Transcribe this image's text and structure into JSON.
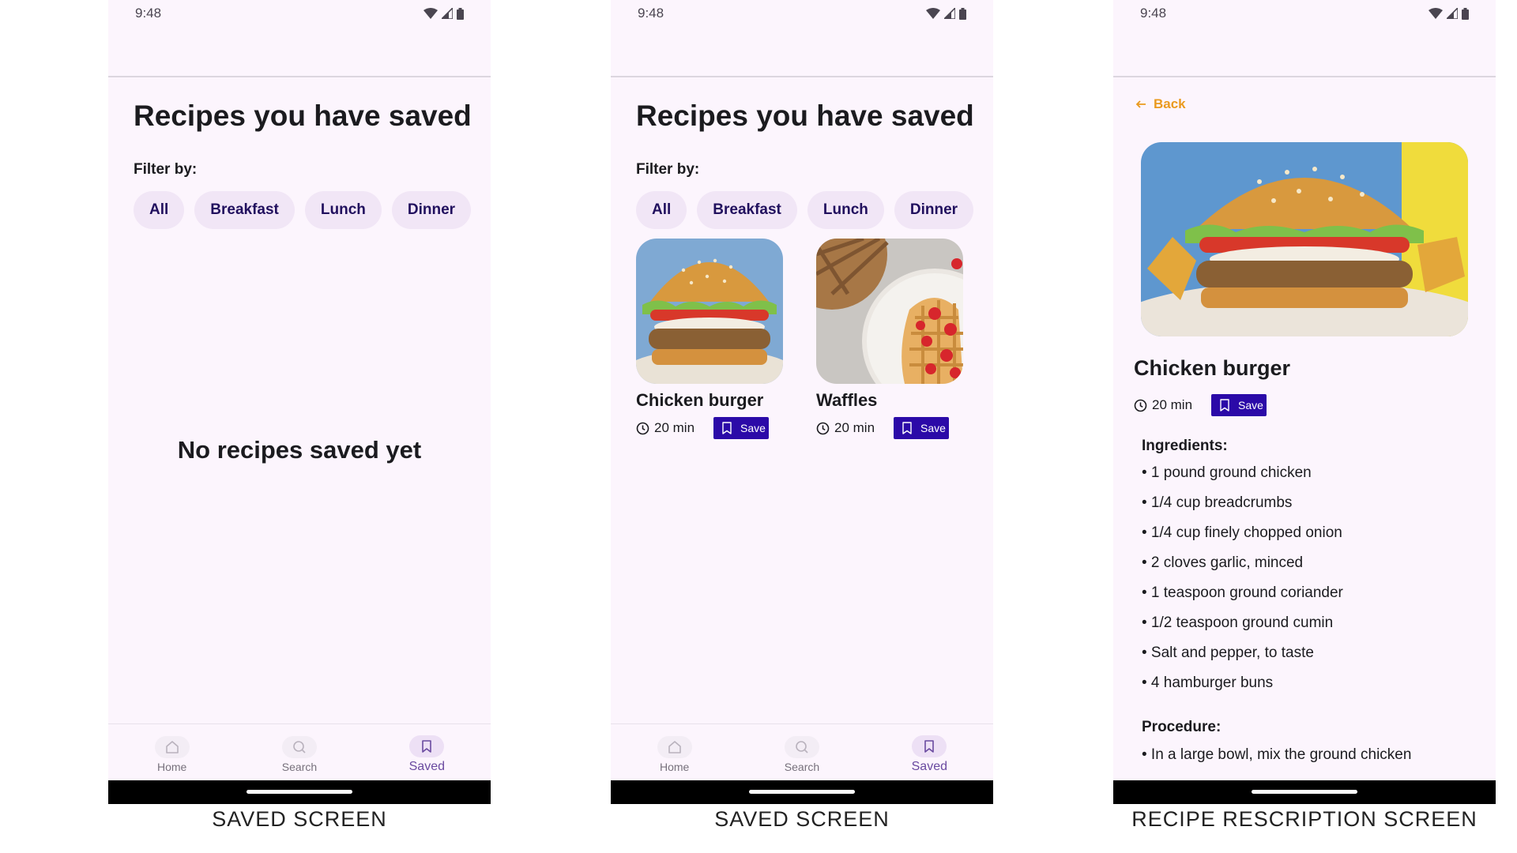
{
  "status": {
    "time": "9:48"
  },
  "screens": [
    {
      "header": {
        "title": "Recipes you have saved"
      },
      "filter": {
        "label": "Filter by:",
        "chips": [
          "All",
          "Breakfast",
          "Lunch",
          "Dinner"
        ]
      },
      "empty_message": "No recipes saved yet",
      "nav": [
        "Home",
        "Search",
        "Saved"
      ],
      "active_nav": "Saved",
      "caption": "SAVED SCREEN"
    },
    {
      "header": {
        "title": "Recipes you have saved"
      },
      "filter": {
        "label": "Filter by:",
        "chips": [
          "All",
          "Breakfast",
          "Lunch",
          "Dinner"
        ]
      },
      "cards": [
        {
          "name": "Chicken burger",
          "time": "20 min",
          "save_label": "Save",
          "image": "chicken-burger"
        },
        {
          "name": "Waffles",
          "time": "20 min",
          "save_label": "Save",
          "image": "waffles"
        }
      ],
      "nav": [
        "Home",
        "Search",
        "Saved"
      ],
      "active_nav": "Saved",
      "caption": "SAVED SCREEN"
    },
    {
      "back_label": "Back",
      "recipe": {
        "name": "Chicken burger",
        "time": "20 min",
        "save_label": "Save",
        "image": "chicken-burger",
        "ingredients_heading": "Ingredients:",
        "ingredients": [
          "• 1 pound ground chicken",
          "• 1/4 cup breadcrumbs",
          "• 1/4 cup finely chopped onion",
          "• 2 cloves garlic, minced",
          "• 1 teaspoon ground coriander",
          "• 1/2 teaspoon ground cumin",
          "• Salt and pepper, to taste",
          "• 4 hamburger buns"
        ],
        "procedure_heading": "Procedure:",
        "procedure_first_line": "• In a large bowl, mix the ground chicken"
      },
      "caption": "RECIPE RESCRIPTION SCREEN"
    }
  ],
  "colors": {
    "background": "#fcf5fd",
    "chip": "#f1e6f6",
    "chip_text": "#21105e",
    "save_button": "#2b0aa8",
    "back_link": "#ea9a1e",
    "nav_active": "#6a4aa0"
  }
}
